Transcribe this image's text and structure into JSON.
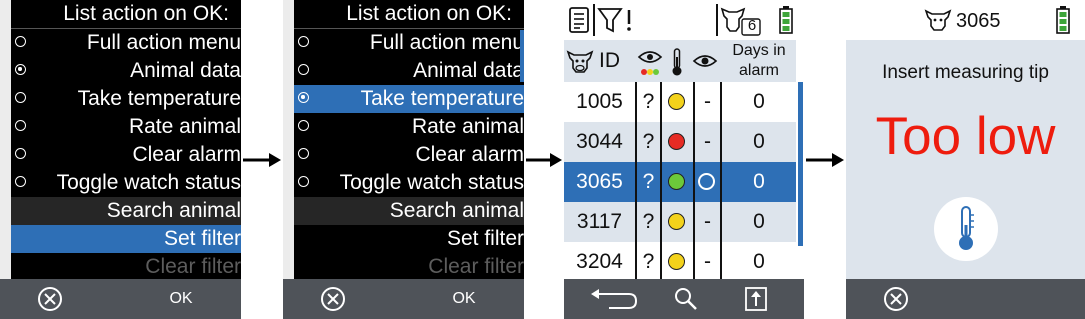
{
  "arrows": 3,
  "screen1": {
    "title": "List action on OK:",
    "items": [
      {
        "label": "Full action menu",
        "radio": true,
        "checked": false
      },
      {
        "label": "Animal data",
        "radio": true,
        "checked": true
      },
      {
        "label": "Take temperature",
        "radio": true,
        "checked": false
      },
      {
        "label": "Rate animal",
        "radio": true,
        "checked": false
      },
      {
        "label": "Clear alarm",
        "radio": true,
        "checked": false
      },
      {
        "label": "Toggle watch status",
        "radio": true,
        "checked": false
      },
      {
        "label": "Search animal",
        "radio": false
      },
      {
        "label": "Set filter",
        "radio": false
      },
      {
        "label": "Clear filter",
        "radio": false
      }
    ],
    "softkey_left_icon": "cancel-circle-icon",
    "softkey_right": "OK"
  },
  "screen2": {
    "title": "List action on OK:",
    "items": [
      {
        "label": "Full action menu",
        "radio": true,
        "checked": false
      },
      {
        "label": "Animal data",
        "radio": true,
        "checked": false
      },
      {
        "label": "Take temperature",
        "radio": true,
        "checked": true
      },
      {
        "label": "Rate animal",
        "radio": true,
        "checked": false
      },
      {
        "label": "Clear alarm",
        "radio": true,
        "checked": false
      },
      {
        "label": "Toggle watch status",
        "radio": true,
        "checked": false
      },
      {
        "label": "Search animal",
        "radio": false
      },
      {
        "label": "Set filter",
        "radio": false
      },
      {
        "label": "Clear filter",
        "radio": false
      }
    ],
    "softkey_left_icon": "cancel-circle-icon",
    "softkey_right": "OK"
  },
  "screen3": {
    "status_count": "6",
    "headers": {
      "id": "ID",
      "days_line1": "Days in",
      "days_line2": "alarm"
    },
    "rows": [
      {
        "id": "1005",
        "q": "?",
        "status_color": "#f3d21b",
        "watch": "-",
        "days": "0"
      },
      {
        "id": "3044",
        "q": "?",
        "status_color": "#e62b24",
        "watch": "-",
        "days": "0"
      },
      {
        "id": "3065",
        "q": "?",
        "status_color": "#6cc93a",
        "watch": "circle",
        "days": "0"
      },
      {
        "id": "3117",
        "q": "?",
        "status_color": "#f3d21b",
        "watch": "-",
        "days": "0"
      },
      {
        "id": "3204",
        "q": "?",
        "status_color": "#f3d21b",
        "watch": "-",
        "days": "0"
      }
    ],
    "softkeys": [
      "back-arrow-icon",
      "search-icon",
      "export-icon"
    ]
  },
  "screen4": {
    "animal_id": "3065",
    "prompt": "Insert measuring tip",
    "message": "Too low",
    "message_color": "#ee1c0e",
    "softkey_left_icon": "cancel-circle-icon"
  },
  "colors": {
    "accent_blue": "#2e6fb6",
    "softkey_bar": "#4f5359",
    "battery_green": "#3ea53a"
  }
}
